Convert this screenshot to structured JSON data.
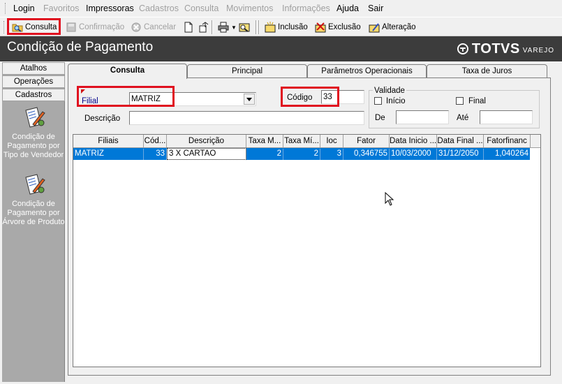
{
  "menu": {
    "items": [
      {
        "label": "Login",
        "enabled": true
      },
      {
        "label": "Favoritos",
        "enabled": false
      },
      {
        "label": "Impressoras",
        "enabled": true
      },
      {
        "label": "Cadastros",
        "enabled": false
      },
      {
        "label": "Consulta",
        "enabled": false
      },
      {
        "label": "Movimentos",
        "enabled": false
      },
      {
        "label": "Informações",
        "enabled": false
      },
      {
        "label": "Ajuda",
        "enabled": true
      },
      {
        "label": "Sair",
        "enabled": true
      }
    ]
  },
  "toolbar": {
    "consulta": "Consulta",
    "confirmacao": "Confirmação",
    "cancelar": "Cancelar",
    "inclusao": "Inclusão",
    "exclusao": "Exclusão",
    "alteracao": "Alteração"
  },
  "header": {
    "title": "Condição de Pagamento",
    "logo_word": "TOTVS",
    "logo_sub": "VAREJO"
  },
  "sidebar": {
    "sections": [
      "Atalhos",
      "Operações",
      "Cadastros"
    ],
    "items": [
      {
        "label": "Condição de Pagamento por Tipo de Vendedor",
        "icon": "document-edit-icon"
      },
      {
        "label": "Condição de Pagamento por Árvore de Produto",
        "icon": "document-edit-icon"
      }
    ]
  },
  "tabs": [
    {
      "label": "Consulta",
      "active": true
    },
    {
      "label": "Principal",
      "active": false
    },
    {
      "label": "Parâmetros Operacionais",
      "active": false
    },
    {
      "label": "Taxa de Juros",
      "active": false
    }
  ],
  "form": {
    "filial_label": "Filial",
    "filial_value": "MATRIZ",
    "codigo_label": "Código",
    "codigo_value": "33",
    "descricao_label": "Descrição",
    "descricao_value": "",
    "validade": {
      "title": "Validade",
      "inicio_label": "Início",
      "final_label": "Final",
      "de_label": "De",
      "ate_label": "Até",
      "inicio_checked": false,
      "final_checked": false
    }
  },
  "grid": {
    "columns": [
      "Filiais",
      "Cód...",
      "Descrição",
      "Taxa M...",
      "Taxa Mí...",
      "Ioc",
      "Fator",
      "Data Inicio ...",
      "Data Final ...",
      "Fatorfinanc"
    ],
    "rows": [
      [
        "MATRIZ",
        "33",
        "3 X CARTAO",
        "2",
        "2",
        "3",
        "0,346755",
        "10/03/2000",
        "31/12/2050",
        "1,040264"
      ]
    ]
  },
  "colors": {
    "highlight_box": "#e0101f",
    "selection": "#0078d7",
    "title_band": "#3c3c3c",
    "sidebar_bg": "#a9a9a9"
  }
}
